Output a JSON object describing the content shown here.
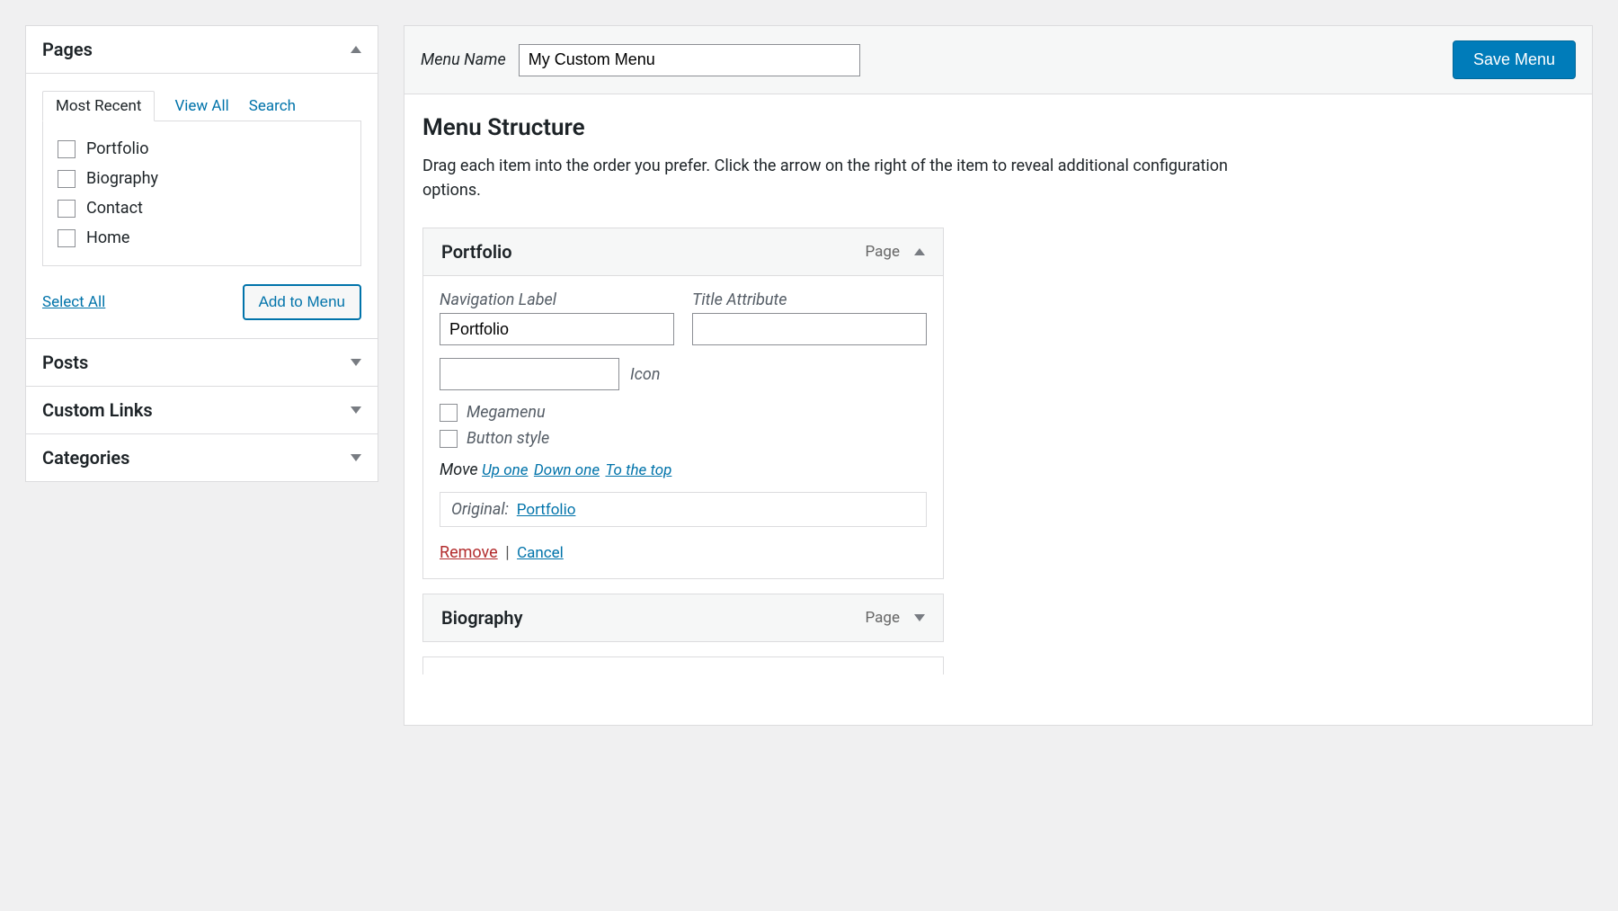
{
  "sidebar": {
    "panels": [
      {
        "title": "Pages",
        "expanded": true
      },
      {
        "title": "Posts",
        "expanded": false
      },
      {
        "title": "Custom Links",
        "expanded": false
      },
      {
        "title": "Categories",
        "expanded": false
      }
    ],
    "tabs": {
      "most_recent": "Most Recent",
      "view_all": "View All",
      "search": "Search"
    },
    "pages": [
      "Portfolio",
      "Biography",
      "Contact",
      "Home"
    ],
    "select_all": "Select All",
    "add_to_menu": "Add to Menu"
  },
  "menu": {
    "name_label": "Menu Name",
    "name_value": "My Custom Menu",
    "save_button": "Save Menu",
    "structure_title": "Menu Structure",
    "help_text": "Drag each item into the order you prefer. Click the arrow on the right of the item to reveal additional configuration options.",
    "items": [
      {
        "title": "Portfolio",
        "type": "Page",
        "expanded": true,
        "nav_label_label": "Navigation Label",
        "nav_label_value": "Portfolio",
        "title_attr_label": "Title Attribute",
        "title_attr_value": "",
        "icon_label": "Icon",
        "icon_value": "",
        "megamenu_label": "Megamenu",
        "button_style_label": "Button style",
        "move_label": "Move",
        "move_up": "Up one",
        "move_down": "Down one",
        "move_top": "To the top",
        "original_label": "Original:",
        "original_link": "Portfolio",
        "remove_label": "Remove",
        "cancel_label": "Cancel"
      },
      {
        "title": "Biography",
        "type": "Page",
        "expanded": false
      }
    ]
  }
}
